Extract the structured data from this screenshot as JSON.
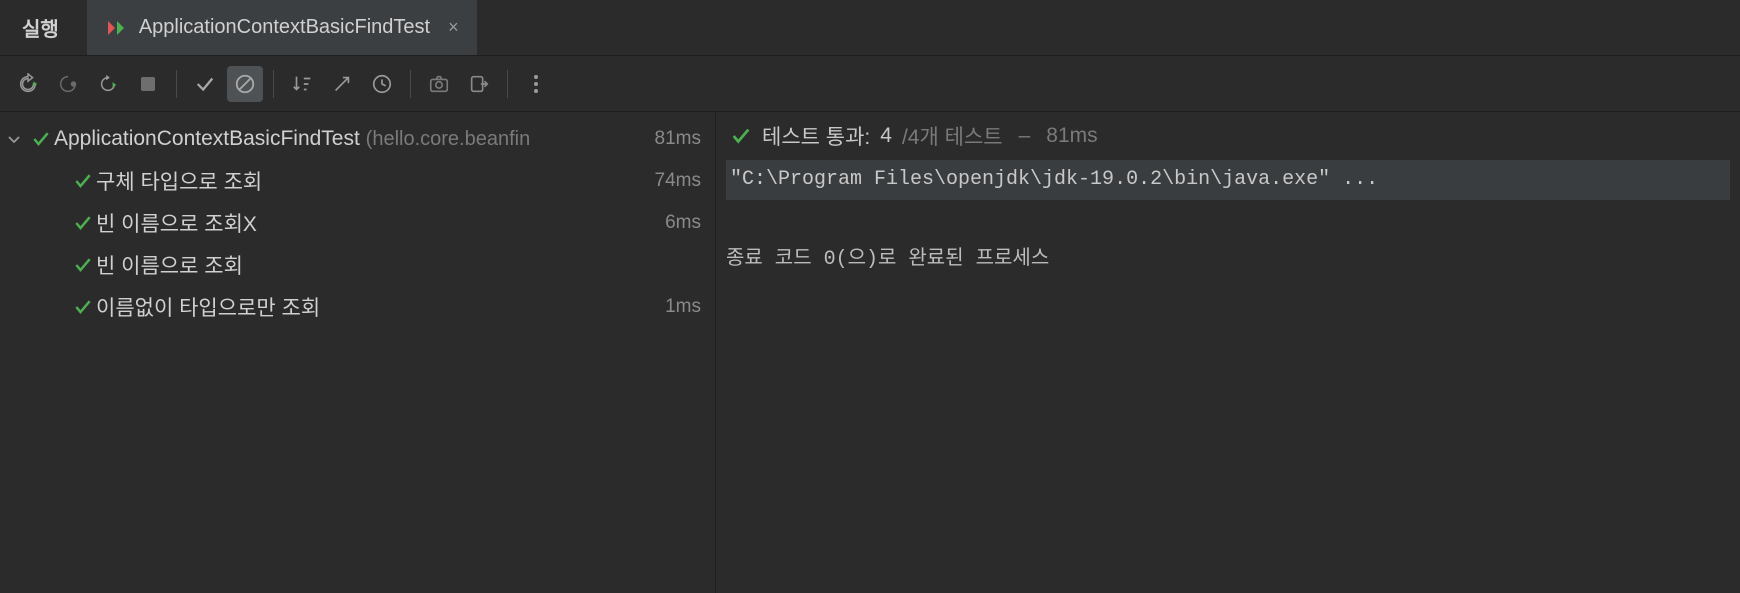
{
  "header": {
    "run_label": "실행",
    "tab": {
      "title": "ApplicationContextBasicFindTest",
      "close": "×"
    }
  },
  "tree": {
    "root": {
      "name": "ApplicationContextBasicFindTest",
      "sub": "(hello.core.beanfin",
      "time": "81ms"
    },
    "children": [
      {
        "name": "구체 타입으로 조회",
        "time": "74ms"
      },
      {
        "name": "빈 이름으로 조회X",
        "time": "6ms"
      },
      {
        "name": "빈 이름으로 조회",
        "time": ""
      },
      {
        "name": "이름없이 타입으로만 조회",
        "time": "1ms"
      }
    ]
  },
  "summary": {
    "label": "테스트 통과:",
    "passed": "4",
    "total_text": "/4개 테스트",
    "dash": "–",
    "time": "81ms"
  },
  "console": {
    "cmd": "\"C:\\Program Files\\openjdk\\jdk-19.0.2\\bin\\java.exe\" ...",
    "exit": "종료 코드 0(으)로 완료된 프로세스"
  }
}
